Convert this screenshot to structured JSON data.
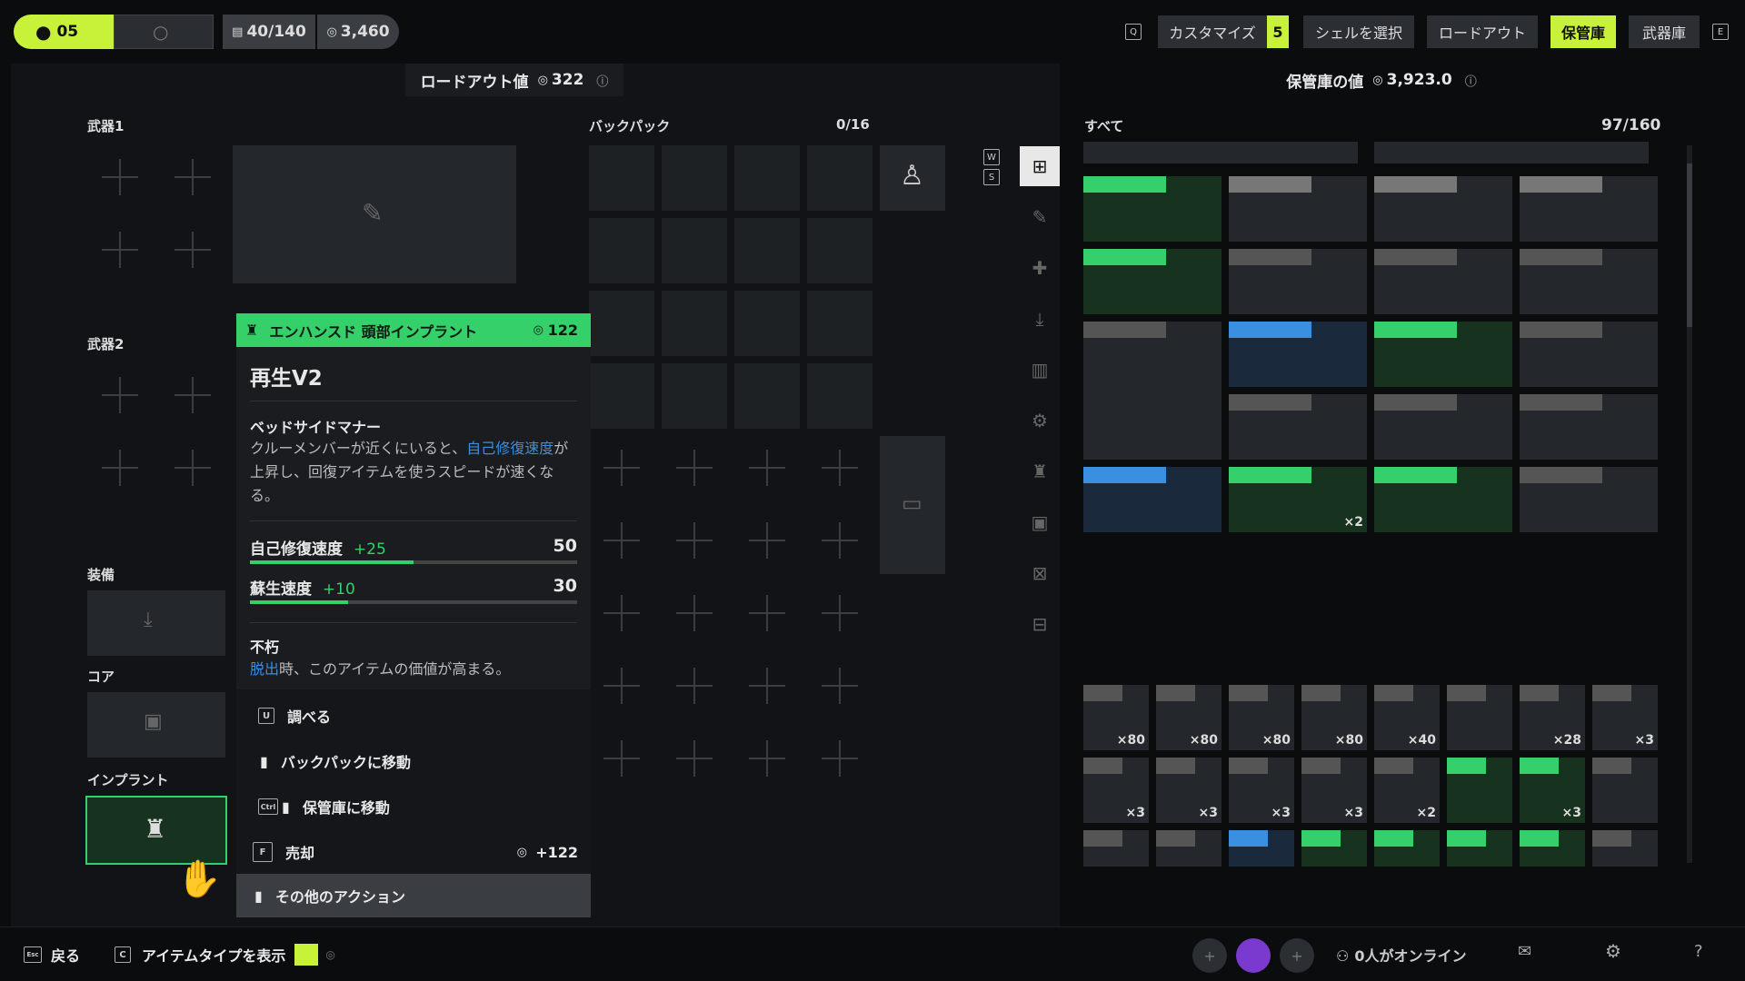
{
  "top": {
    "level": "05",
    "slots": "40/140",
    "currency": "3,460",
    "customize": "カスタマイズ",
    "customize_badge": "5",
    "select_shell": "シェルを選択",
    "loadout": "ロードアウト",
    "vault": "保管庫",
    "armory": "武器庫",
    "key_left": "Q",
    "key_right": "E"
  },
  "loadout_value": {
    "label": "ロードアウト値",
    "amount": "322"
  },
  "vault_value": {
    "label": "保管庫の値",
    "amount": "3,923.0"
  },
  "left": {
    "weapon1": "武器1",
    "weapon2": "武器2",
    "equipment": "装備",
    "core": "コア",
    "implant": "インプラント",
    "backpack": "バックパック",
    "backpack_count": "0/16",
    "side_keys": [
      "W",
      "S"
    ]
  },
  "tooltip": {
    "category": "エンハンスド 頭部インプラント",
    "price": "122",
    "name": "再生V2",
    "perk_title": "ベッドサイドマナー",
    "perk_desc_1": "クルーメンバーが近くにいると、",
    "perk_desc_link": "自己修復速度",
    "perk_desc_2": "が上昇し、回復アイテムを使うスピードが速くなる。",
    "stats": [
      {
        "label": "自己修復速度",
        "bonus": "+25",
        "value": "50",
        "fill": 0.5
      },
      {
        "label": "蘇生速度",
        "bonus": "+10",
        "value": "30",
        "fill": 0.3
      }
    ],
    "trait_title": "不朽",
    "trait_link": "脱出",
    "trait_desc": "時、このアイテムの価値が高まる。",
    "actions": {
      "inspect": "調べる",
      "inspect_key": "U",
      "to_backpack": "バックパックに移動",
      "to_vault": "保管庫に移動",
      "to_vault_key": "Ctrl",
      "sell": "売却",
      "sell_key": "F",
      "sell_value": "+122",
      "other": "その他のアクション"
    }
  },
  "vault": {
    "filter": "すべて",
    "count": "97/160"
  },
  "items": [
    {
      "row": 0,
      "col": 0,
      "w": 1,
      "h": 1,
      "tag": "#35d06a",
      "bg": "#17321f",
      "count": ""
    },
    {
      "row": 0,
      "col": 1,
      "w": 1,
      "h": 1,
      "tag": "#777",
      "bg": "#24272b",
      "count": ""
    },
    {
      "row": 0,
      "col": 2,
      "w": 1,
      "h": 1,
      "tag": "#777",
      "bg": "#24272b",
      "count": ""
    },
    {
      "row": 0,
      "col": 3,
      "w": 1,
      "h": 1,
      "tag": "#777",
      "bg": "#24272b",
      "count": ""
    },
    {
      "row": 1,
      "col": 0,
      "w": 1,
      "h": 1,
      "tag": "#35d06a",
      "bg": "#17321f",
      "count": ""
    },
    {
      "row": 1,
      "col": 1,
      "w": 1,
      "h": 1,
      "tag": "#555",
      "bg": "#24272b",
      "count": ""
    },
    {
      "row": 1,
      "col": 2,
      "w": 1,
      "h": 1,
      "tag": "#555",
      "bg": "#24272b",
      "count": ""
    },
    {
      "row": 1,
      "col": 3,
      "w": 1,
      "h": 1,
      "tag": "#555",
      "bg": "#24272b",
      "count": ""
    },
    {
      "row": 2,
      "col": 0,
      "w": 1,
      "h": 2,
      "tag": "#555",
      "bg": "#24272b",
      "count": ""
    },
    {
      "row": 2,
      "col": 1,
      "w": 1,
      "h": 1,
      "tag": "#3a8fe0",
      "bg": "#1a2a3c",
      "count": ""
    },
    {
      "row": 2,
      "col": 2,
      "w": 1,
      "h": 1,
      "tag": "#35d06a",
      "bg": "#17321f",
      "count": ""
    },
    {
      "row": 2,
      "col": 3,
      "w": 1,
      "h": 1,
      "tag": "#555",
      "bg": "#24272b",
      "count": ""
    },
    {
      "row": 3,
      "col": 1,
      "w": 1,
      "h": 1,
      "tag": "#555",
      "bg": "#24272b",
      "count": ""
    },
    {
      "row": 3,
      "col": 2,
      "w": 1,
      "h": 1,
      "tag": "#555",
      "bg": "#24272b",
      "count": ""
    },
    {
      "row": 3,
      "col": 3,
      "w": 1,
      "h": 1,
      "tag": "#555",
      "bg": "#24272b",
      "count": ""
    },
    {
      "row": 4,
      "col": 0,
      "w": 1,
      "h": 1,
      "tag": "#3a8fe0",
      "bg": "#1a2a3c",
      "count": ""
    },
    {
      "row": 4,
      "col": 1,
      "w": 1,
      "h": 1,
      "tag": "#35d06a",
      "bg": "#17321f",
      "count": "×2"
    },
    {
      "row": 4,
      "col": 2,
      "w": 1,
      "h": 1,
      "tag": "#35d06a",
      "bg": "#17321f",
      "count": ""
    },
    {
      "row": 4,
      "col": 3,
      "w": 1,
      "h": 1,
      "tag": "#555",
      "bg": "#24272b",
      "count": ""
    }
  ],
  "small_items": [
    {
      "row": 0,
      "col": 0,
      "tag": "#555",
      "bg": "#24272b",
      "count": "×80"
    },
    {
      "row": 0,
      "col": 1,
      "tag": "#555",
      "bg": "#24272b",
      "count": "×80"
    },
    {
      "row": 0,
      "col": 2,
      "tag": "#555",
      "bg": "#24272b",
      "count": "×80"
    },
    {
      "row": 0,
      "col": 3,
      "tag": "#555",
      "bg": "#24272b",
      "count": "×80"
    },
    {
      "row": 0,
      "col": 4,
      "tag": "#555",
      "bg": "#24272b",
      "count": "×40"
    },
    {
      "row": 0,
      "col": 5,
      "tag": "#555",
      "bg": "#24272b",
      "count": ""
    },
    {
      "row": 0,
      "col": 6,
      "tag": "#555",
      "bg": "#24272b",
      "count": "×28"
    },
    {
      "row": 0,
      "col": 7,
      "tag": "#555",
      "bg": "#24272b",
      "count": "×3"
    },
    {
      "row": 1,
      "col": 0,
      "tag": "#555",
      "bg": "#24272b",
      "count": "×3"
    },
    {
      "row": 1,
      "col": 1,
      "tag": "#555",
      "bg": "#24272b",
      "count": "×3"
    },
    {
      "row": 1,
      "col": 2,
      "tag": "#555",
      "bg": "#24272b",
      "count": "×3"
    },
    {
      "row": 1,
      "col": 3,
      "tag": "#555",
      "bg": "#24272b",
      "count": "×3"
    },
    {
      "row": 1,
      "col": 4,
      "tag": "#555",
      "bg": "#24272b",
      "count": "×2"
    },
    {
      "row": 1,
      "col": 5,
      "tag": "#35d06a",
      "bg": "#17321f",
      "count": ""
    },
    {
      "row": 1,
      "col": 6,
      "tag": "#35d06a",
      "bg": "#17321f",
      "count": "×3"
    },
    {
      "row": 1,
      "col": 7,
      "tag": "#555",
      "bg": "#24272b",
      "count": ""
    },
    {
      "row": 2,
      "col": 0,
      "tag": "#555",
      "bg": "#24272b",
      "count": ""
    },
    {
      "row": 2,
      "col": 1,
      "tag": "#555",
      "bg": "#24272b",
      "count": ""
    },
    {
      "row": 2,
      "col": 2,
      "tag": "#3a8fe0",
      "bg": "#1a2a3c",
      "count": ""
    },
    {
      "row": 2,
      "col": 3,
      "tag": "#35d06a",
      "bg": "#17321f",
      "count": ""
    },
    {
      "row": 2,
      "col": 4,
      "tag": "#35d06a",
      "bg": "#17321f",
      "count": ""
    },
    {
      "row": 2,
      "col": 5,
      "tag": "#35d06a",
      "bg": "#17321f",
      "count": ""
    },
    {
      "row": 2,
      "col": 6,
      "tag": "#35d06a",
      "bg": "#17321f",
      "count": ""
    },
    {
      "row": 2,
      "col": 7,
      "tag": "#555",
      "bg": "#24272b",
      "count": ""
    }
  ],
  "bottom": {
    "back": "戻る",
    "back_key": "Esc",
    "show_type": "アイテムタイプを表示",
    "show_type_key": "C",
    "online": "0人がオンライン"
  },
  "colors": {
    "accent": "#c8f23a",
    "rare": "#35d06a",
    "link": "#3a8fe0"
  }
}
